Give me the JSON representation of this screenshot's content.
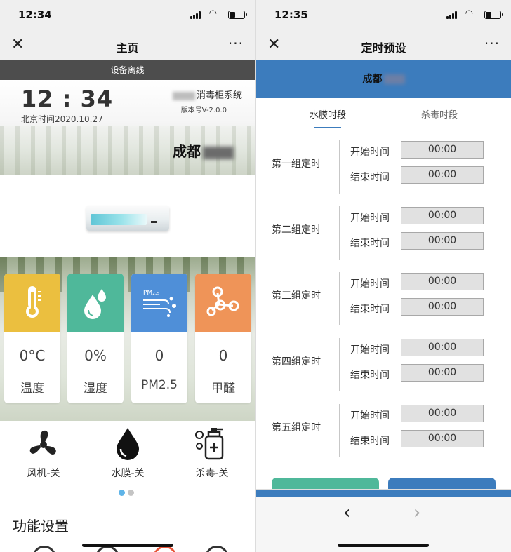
{
  "left": {
    "status": {
      "time": "12:34"
    },
    "nav": {
      "close": "✕",
      "title": "主页",
      "more": "···"
    },
    "offline_banner": "设备离线",
    "clock": "12 : 34",
    "date": "北京时间2020.10.27",
    "system_name": "消毒柜系统",
    "version": "版本号V-2.0.0",
    "location": "成都",
    "cards": [
      {
        "value": "0°C",
        "label": "温度",
        "color": "#ebbf3f",
        "icon": "thermometer-icon"
      },
      {
        "value": "0%",
        "label": "湿度",
        "color": "#4fb89a",
        "icon": "droplets-icon"
      },
      {
        "value": "0",
        "label": "PM2.5",
        "color": "#4f8fd8",
        "icon": "pm-wind-icon",
        "icon_text": "PM₂.₅"
      },
      {
        "value": "0",
        "label": "甲醛",
        "color": "#ef9458",
        "icon": "molecule-icon"
      }
    ],
    "modes": [
      {
        "label": "风机-关",
        "icon": "fan-icon"
      },
      {
        "label": "水膜-关",
        "icon": "water-drop-icon"
      },
      {
        "label": "杀毒-关",
        "icon": "disinfect-bottle-icon"
      }
    ],
    "func_title": "功能设置"
  },
  "right": {
    "status": {
      "time": "12:35"
    },
    "nav": {
      "close": "✕",
      "title": "定时预设",
      "more": "···"
    },
    "location": "成都",
    "tabs": [
      {
        "label": "水膜时段"
      },
      {
        "label": "杀毒时段"
      }
    ],
    "groups": [
      {
        "name": "第一组定时",
        "start_label": "开始时间",
        "start": "00:00",
        "end_label": "结束时间",
        "end": "00:00"
      },
      {
        "name": "第二组定时",
        "start_label": "开始时间",
        "start": "00:00",
        "end_label": "结束时间",
        "end": "00:00"
      },
      {
        "name": "第三组定时",
        "start_label": "开始时间",
        "start": "00:00",
        "end_label": "结束时间",
        "end": "00:00"
      },
      {
        "name": "第四组定时",
        "start_label": "开始时间",
        "start": "00:00",
        "end_label": "结束时间",
        "end": "00:00"
      },
      {
        "name": "第五组定时",
        "start_label": "开始时间",
        "start": "00:00",
        "end_label": "结束时间",
        "end": "00:00"
      }
    ],
    "bottom": {
      "back": "‹",
      "forward": "›"
    }
  },
  "colors": {
    "accent": "#3c7cbd",
    "green": "#4fb89a",
    "offline": "#4d4d4d"
  }
}
